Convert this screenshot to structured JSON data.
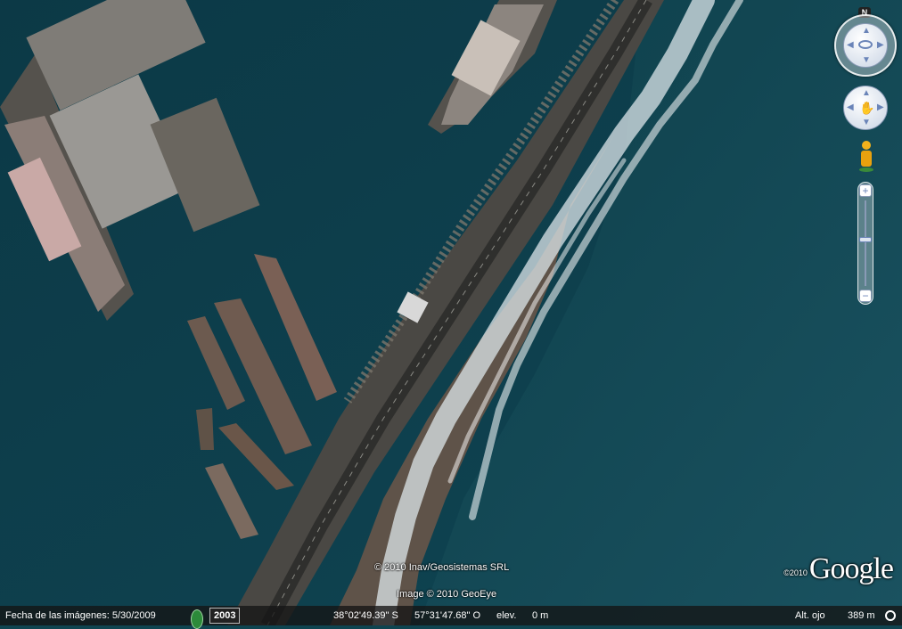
{
  "map": {
    "type": "satellite",
    "place_features": [
      "harbor",
      "breakwater",
      "coastal-road",
      "beach",
      "ocean-surf"
    ]
  },
  "attribution": {
    "line1": "© 2010 Inav/Geosistemas SRL",
    "line2": "Image © 2010 GeoEye"
  },
  "logo": {
    "copyright": "©2010",
    "text": "Google"
  },
  "status_bar": {
    "imagery_date": "Fecha de las imágenes: 5/30/2009",
    "historical_year": "2003",
    "latitude": "38°02'49.39\" S",
    "longitude": "57°31'47.68\" O",
    "elevation_label": "elev.",
    "elevation_value": "0 m",
    "eye_alt_label": "Alt. ojo",
    "eye_alt_value": "389 m"
  },
  "controls": {
    "north_label": "N",
    "zoom_in": "+",
    "zoom_out": "−",
    "zoom_level": 0.45
  },
  "colors": {
    "water": "#0f4450",
    "open_sea": "#164b57",
    "sand": "#5f5349",
    "road": "#3a3a38",
    "surf": "#e6eef0",
    "accent": "#6a84b8"
  }
}
